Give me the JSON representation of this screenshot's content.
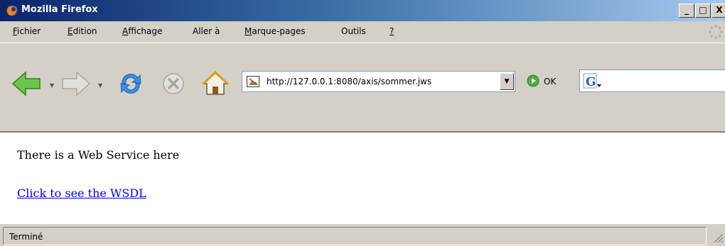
{
  "window": {
    "title": "Mozilla Firefox",
    "buttons": {
      "minimize": "_",
      "maximize": "□",
      "close": "X"
    }
  },
  "menu": {
    "items": [
      "Fichier",
      "Edition",
      "Affichage",
      "Aller à",
      "Marque-pages",
      "Outils",
      "?"
    ]
  },
  "nav": {
    "icons": [
      "back-arrow-icon",
      "forward-arrow-icon",
      "reload-icon",
      "stop-icon",
      "home-icon"
    ],
    "url": "http://127.0.0.1:8080/axis/sommer.jws",
    "go_label": "OK"
  },
  "content": {
    "heading": "There is a Web Service here",
    "link_text": "Click to see the WSDL"
  },
  "status": {
    "text": "Terminé"
  },
  "colors": {
    "chrome": "#d4d0c8",
    "titlebar_start": "#0a246a",
    "titlebar_end": "#a6caf0",
    "link": "#0000ee"
  }
}
